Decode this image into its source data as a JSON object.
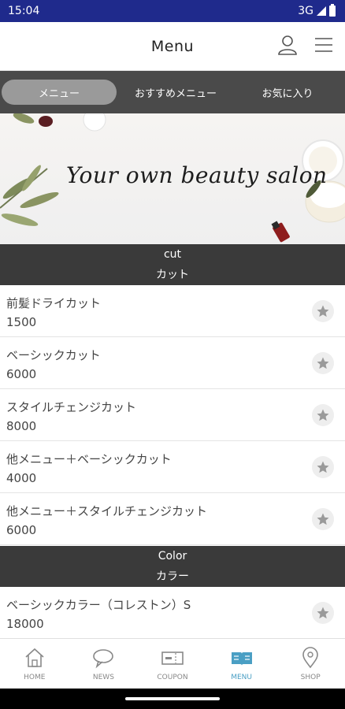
{
  "status_bar": {
    "time": "15:04",
    "network": "3G"
  },
  "header": {
    "title": "Menu",
    "user_icon": "user-icon",
    "menu_icon": "hamburger-icon"
  },
  "tabs": [
    {
      "label": "メニュー",
      "active": true
    },
    {
      "label": "おすすめメニュー",
      "active": false
    },
    {
      "label": "お気に入り",
      "active": false
    }
  ],
  "hero": {
    "text": "Your own beauty salon"
  },
  "sections": [
    {
      "title_en": "cut",
      "title_jp": "カット",
      "items": [
        {
          "name": "前髪ドライカット",
          "price": "1500"
        },
        {
          "name": "ベーシックカット",
          "price": "6000"
        },
        {
          "name": "スタイルチェンジカット",
          "price": "8000"
        },
        {
          "name": "他メニュー＋ベーシックカット",
          "price": "4000"
        },
        {
          "name": "他メニュー＋スタイルチェンジカット",
          "price": "6000"
        }
      ]
    },
    {
      "title_en": "Color",
      "title_jp": "カラー",
      "items": [
        {
          "name": "ベーシックカラー（コレストン）S",
          "price": "18000"
        }
      ]
    }
  ],
  "bottom_nav": [
    {
      "label": "HOME",
      "icon": "home-icon",
      "active": false
    },
    {
      "label": "NEWS",
      "icon": "news-icon",
      "active": false
    },
    {
      "label": "COUPON",
      "icon": "coupon-icon",
      "active": false
    },
    {
      "label": "MENU",
      "icon": "menu-book-icon",
      "active": true
    },
    {
      "label": "SHOP",
      "icon": "map-pin-icon",
      "active": false
    }
  ],
  "colors": {
    "status_bar": "#1f2a8c",
    "tab_bar": "#4a4a4a",
    "section_header": "#3a3a3a",
    "active_nav": "#4a9fc4"
  }
}
